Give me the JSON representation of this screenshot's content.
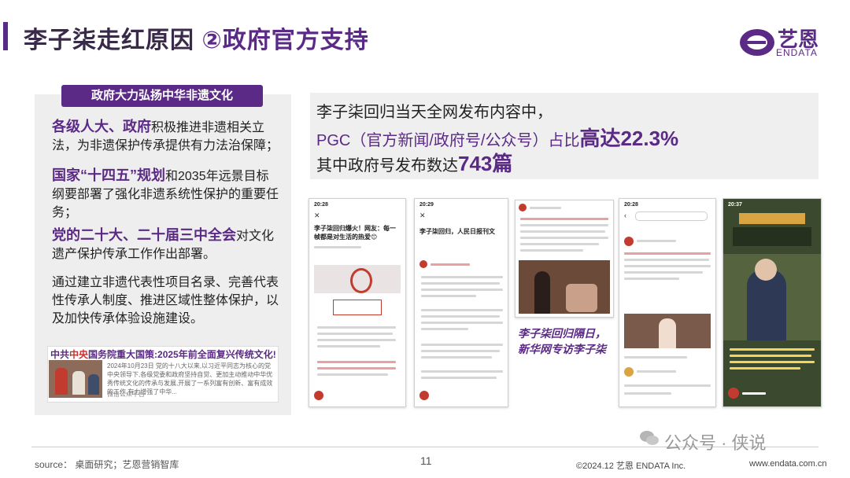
{
  "header": {
    "title_main": "李子柒走红原因 ",
    "title_accent": "②政府官方支持",
    "logo_text": "艺恩",
    "logo_sub": "ENDATA"
  },
  "left_panel": {
    "pill_label": "政府大力弘扬中华非遗文化",
    "p1_hl": "各级人大、政府",
    "p1_text": "积极推进非遗相关立法，为非遗保护传承提供有力法治保障；",
    "p2_hl": "国家“十四五”规划",
    "p2_text": "和2035年远景目标纲要部署了强化非遗系统性保护的重要任务；",
    "p3_hl": "党的二十大、二十届三中全会",
    "p3_text": "对文化遗产保护传承工作作出部署。",
    "p4_text": "通过建立非遗代表性项目名录、完善代表性传承人制度、推进区域性整体保护，以及加快传承体验设施建设。",
    "card": {
      "title_prefix": "中共",
      "title_red": "中央",
      "title_rest": "国务院重大国策:2025年前全面复兴传统文化!",
      "body": "2024年10月23日 党的十八大以来,以习近平同志为核心的党中央领导下,各级党委和政府坚持自觉、更加主动推动中华优秀传统文化的传承与发展,开展了一系列富有创新、富有成效的工作,有力增强了中华...",
      "source": "微信公众平台"
    }
  },
  "stats": {
    "line1": "李子柒回归当天全网发布内容中，",
    "line2_prefix": "PGC（官方新闻/政府号/公众号）占比",
    "line2_big": "高达22.3%",
    "line3_prefix": "其中政府号发布数达",
    "line3_big": "743篇"
  },
  "phones": {
    "p1_time": "20:28",
    "p1_headline": "李子柒回归爆火！网友：每一帧都是对生活的热爱😊",
    "p2_time": "20:29",
    "p2_headline": "李子柒回归，人民日报刊文",
    "p4_time": "20:28",
    "p5_time": "20:37"
  },
  "caption": "李子柒回归隔日，新华网专访李子柒",
  "footer": {
    "source": "source： 桌面研究；艺恩营销智库",
    "page": "11",
    "copyright": "©2024.12  艺恩 ENDATA Inc.",
    "url": "www.endata.com.cn",
    "watermark": "公众号 · 侠说"
  },
  "colors": {
    "accent": "#5b2a86",
    "highlight_red": "#d62b2b"
  }
}
